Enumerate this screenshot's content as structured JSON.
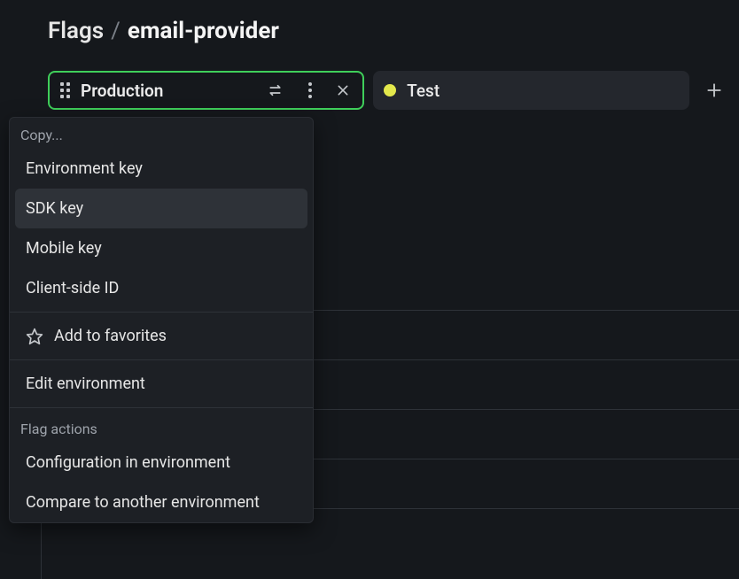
{
  "breadcrumb": {
    "root": "Flags",
    "separator": "/",
    "current": "email-provider"
  },
  "tabs": {
    "active": {
      "label": "Production"
    },
    "inactive": {
      "label": "Test",
      "status_color": "#e3e84c"
    }
  },
  "dropdown": {
    "section1_header": "Copy...",
    "items1": [
      "Environment key",
      "SDK key",
      "Mobile key",
      "Client-side ID"
    ],
    "favorites": "Add to favorites",
    "edit": "Edit environment",
    "section2_header": "Flag actions",
    "items2": [
      "Configuration in environment",
      "Compare to another environment"
    ]
  }
}
